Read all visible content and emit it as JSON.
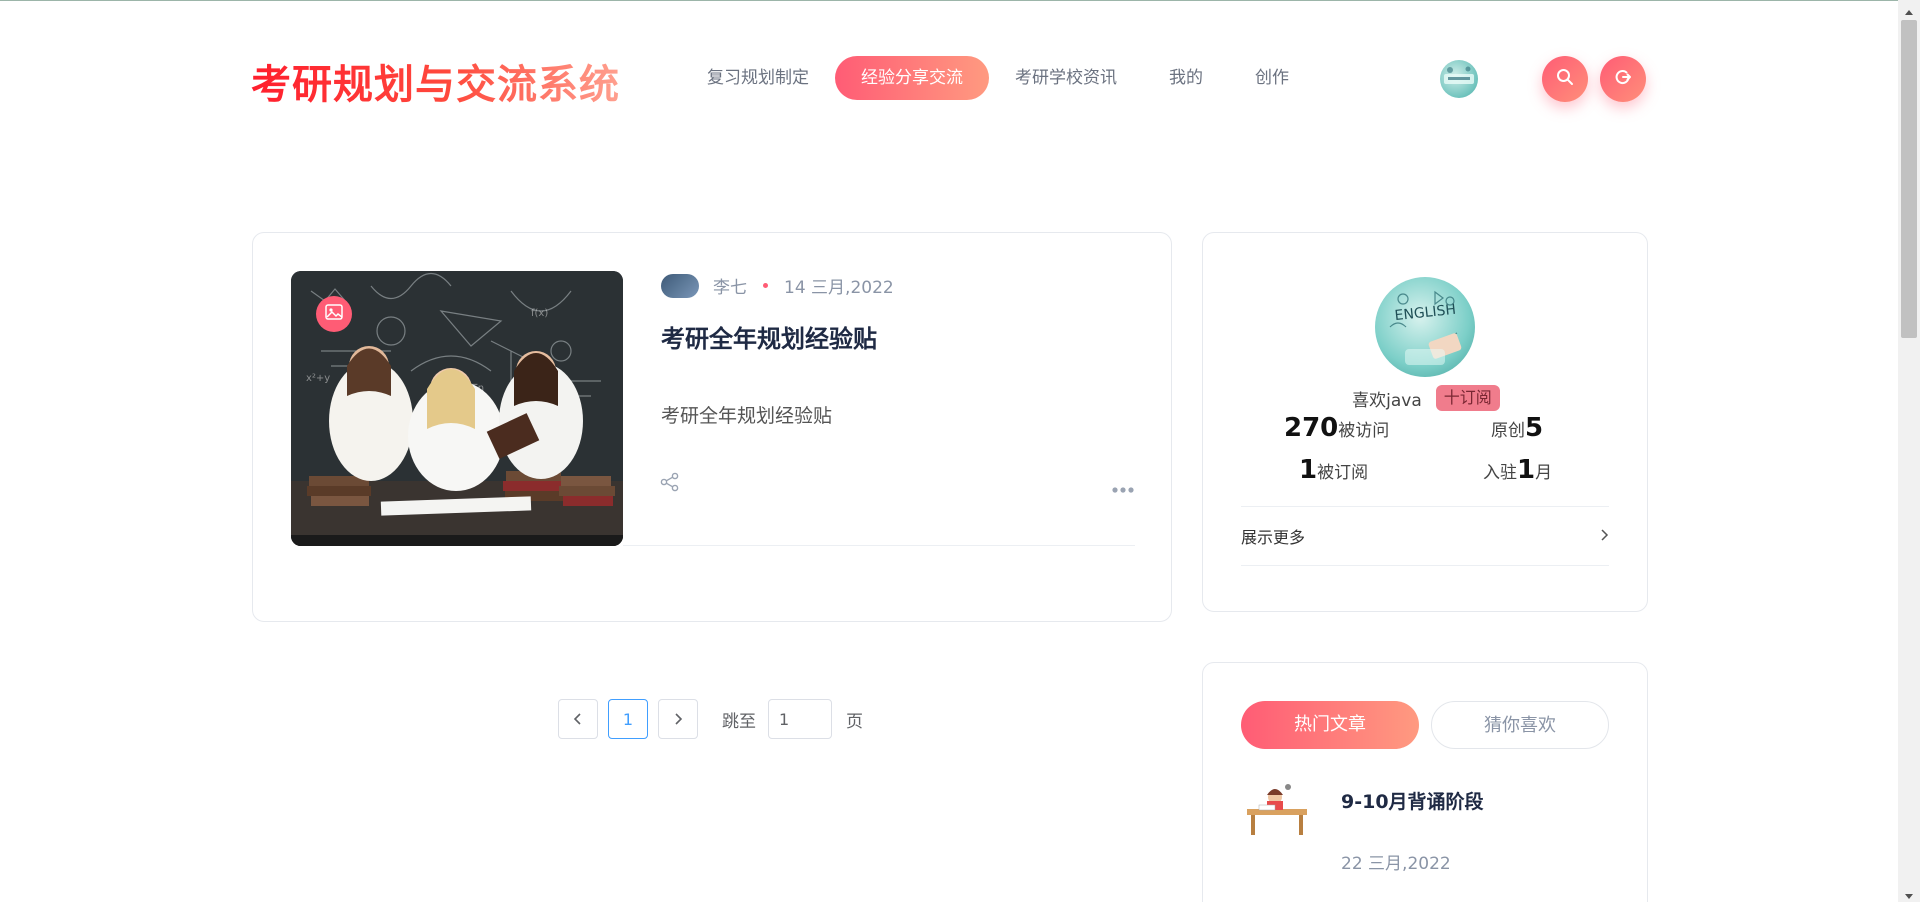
{
  "header": {
    "logo": "考研规划与交流系统",
    "nav": [
      {
        "label": "复习规划制定",
        "active": false
      },
      {
        "label": "经验分享交流",
        "active": true
      },
      {
        "label": "考研学校资讯",
        "active": false
      },
      {
        "label": "我的",
        "active": false
      },
      {
        "label": "创作",
        "active": false
      }
    ],
    "icons": {
      "search": "search-icon",
      "logout": "logout-icon"
    }
  },
  "post": {
    "author": "李七",
    "date": "14 三月,2022",
    "title": "考研全年规划经验贴",
    "summary": "考研全年规划经验贴",
    "icons": {
      "badge": "image-icon",
      "share": "share-icon",
      "more": "more-dots-icon"
    }
  },
  "pagination": {
    "current": "1",
    "jump_label": "跳至",
    "jump_value": "1",
    "page_suffix": "页"
  },
  "profile": {
    "name": "喜欢java",
    "subscribe_label": "十订阅",
    "visits_value": "270",
    "visits_label": "被访问",
    "original_label": "原创",
    "original_value": "5",
    "subscribed_value": "1",
    "subscribed_label": "被订阅",
    "joined_prefix": "入驻",
    "joined_value": "1",
    "joined_suffix": "月",
    "show_more": "展示更多"
  },
  "hot": {
    "tab_hot": "热门文章",
    "tab_guess": "猜你喜欢",
    "item_title": "9-10月背诵阶段",
    "item_date": "22 三月,2022"
  },
  "colors": {
    "accent": "#ff5c75",
    "accent_end": "#ff9a80",
    "logo_start": "#ff1e2d",
    "link_blue": "#409eff"
  }
}
